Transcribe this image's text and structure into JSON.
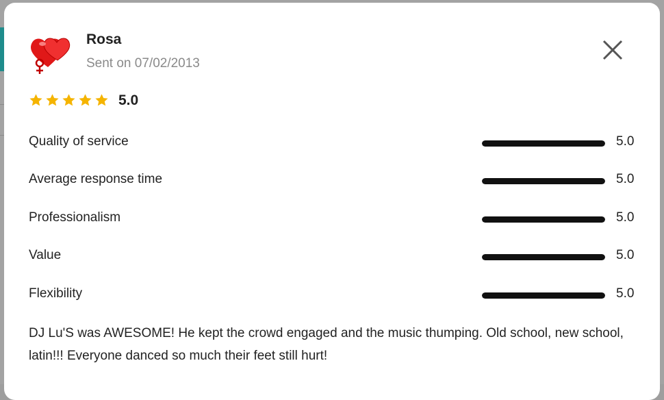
{
  "review": {
    "reviewer_name": "Rosa",
    "sent_date": "Sent on 07/02/2013",
    "overall_rating": "5.0",
    "stars_filled": 5,
    "stars_total": 5,
    "star_color": "#f5b400",
    "categories": [
      {
        "label": "Quality of service",
        "value": "5.0",
        "fill": 1.0
      },
      {
        "label": "Average response time",
        "value": "5.0",
        "fill": 1.0
      },
      {
        "label": "Professionalism",
        "value": "5.0",
        "fill": 1.0
      },
      {
        "label": "Value",
        "value": "5.0",
        "fill": 1.0
      },
      {
        "label": "Flexibility",
        "value": "5.0",
        "fill": 1.0
      }
    ],
    "text": "DJ Lu'S was AWESOME! He kept the crowd engaged and the music thumping. Old school, new school, latin!!! Everyone danced so much their feet still hurt!"
  },
  "icons": {
    "avatar": "hearts-avatar-icon",
    "close": "close-icon",
    "star": "star-icon"
  }
}
